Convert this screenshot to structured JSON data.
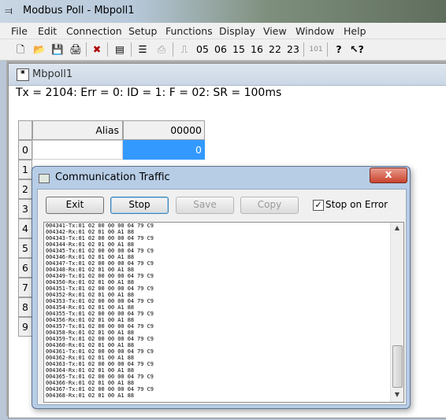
{
  "app": {
    "title": "Modbus Poll - Mbpoll1",
    "icon": "modbus-app-icon"
  },
  "menu": [
    "File",
    "Edit",
    "Connection",
    "Setup",
    "Functions",
    "Display",
    "View",
    "Window",
    "Help"
  ],
  "toolbar": {
    "icons": [
      "new-icon",
      "open-icon",
      "save-icon",
      "print-icon",
      "delete-icon",
      "window-icon",
      "connect-icon",
      "disconnect-icon",
      "pulse-icon",
      "help-icon",
      "context-help-icon"
    ],
    "function_codes": [
      "05",
      "06",
      "15",
      "16",
      "22",
      "23",
      "101"
    ]
  },
  "doc": {
    "title": "Mbpoll1",
    "status": "Tx = 2104: Err = 0: ID = 1: F = 02: SR = 100ms"
  },
  "grid": {
    "alias_header": "Alias",
    "address_header": "00000",
    "row_numbers": [
      "0",
      "1",
      "2",
      "3",
      "4",
      "5",
      "6",
      "7",
      "8",
      "9"
    ],
    "row0_value": "0"
  },
  "dialog": {
    "title": "Communication Traffic",
    "close_label": "x",
    "buttons": {
      "exit": "Exit",
      "stop": "Stop",
      "save": "Save",
      "copy": "Copy"
    },
    "checkbox_label": "Stop on Error",
    "checkbox_checked": true,
    "log": [
      "004341-Tx:01 02 00 00 00 04 79 C9",
      "004342-Rx:01 02 01 00 A1 88",
      "004343-Tx:01 02 00 00 00 04 79 C9",
      "004344-Rx:01 02 01 00 A1 88",
      "004345-Tx:01 02 00 00 00 04 79 C9",
      "004346-Rx:01 02 01 00 A1 88",
      "004347-Tx:01 02 00 00 00 04 79 C9",
      "004348-Rx:01 02 01 00 A1 88",
      "004349-Tx:01 02 00 00 00 04 79 C9",
      "004350-Rx:01 02 01 00 A1 88",
      "004351-Tx:01 02 00 00 00 04 79 C9",
      "004352-Rx:01 02 01 00 A1 88",
      "004353-Tx:01 02 00 00 00 04 79 C9",
      "004354-Rx:01 02 01 00 A1 88",
      "004355-Tx:01 02 00 00 00 04 79 C9",
      "004356-Rx:01 02 01 00 A1 88",
      "004357-Tx:01 02 00 00 00 04 79 C9",
      "004358-Rx:01 02 01 00 A1 88",
      "004359-Tx:01 02 00 00 00 04 79 C9",
      "004360-Rx:01 02 01 00 A1 88",
      "004361-Tx:01 02 00 00 00 04 79 C9",
      "004362-Rx:01 02 01 00 A1 88",
      "004363-Tx:01 02 00 00 00 04 79 C9",
      "004364-Rx:01 02 01 00 A1 88",
      "004365-Tx:01 02 00 00 00 04 79 C9",
      "004366-Rx:01 02 01 00 A1 88",
      "004367-Tx:01 02 00 00 00 04 79 C9",
      "004368-Rx:01 02 01 00 A1 88"
    ]
  },
  "colors": {
    "selected_cell": "#3399ff",
    "title_active": "#b7cde6",
    "close_button": "#c9442e"
  }
}
